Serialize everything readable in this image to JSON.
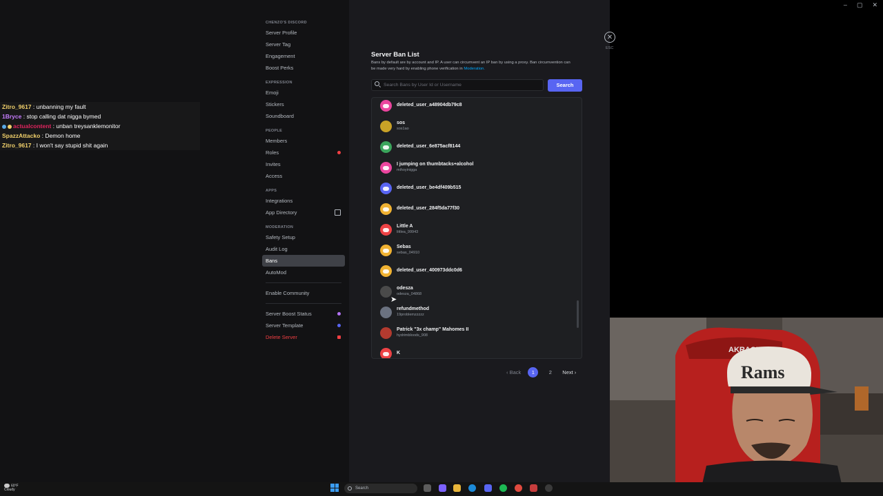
{
  "chat": [
    {
      "user": "Zitro_9617",
      "user_color": "#f2d16b",
      "message": ": unbanning my fault"
    },
    {
      "user": "1Bryce",
      "user_color": "#c77dff",
      "message": ": stop calling dat nigga bymed"
    },
    {
      "user": "actualcontent",
      "user_color": "#e0245e",
      "message": ": unban treysanklemonitor",
      "badges": true
    },
    {
      "user": "SpazzAttacko",
      "user_color": "#f2d16b",
      "message": ": Demon home"
    },
    {
      "user": "Zitro_9617",
      "user_color": "#f2d16b",
      "message": ": I won't say stupid shit again"
    }
  ],
  "sidebar": {
    "server_header": "CHENZO'S DISCORD",
    "items1": [
      "Server Profile",
      "Server Tag",
      "Engagement",
      "Boost Perks"
    ],
    "expression_header": "EXPRESSION",
    "items2": [
      "Emoji",
      "Stickers",
      "Soundboard"
    ],
    "people_header": "PEOPLE",
    "items3": [
      "Members",
      "Roles",
      "Invites",
      "Access"
    ],
    "apps_header": "APPS",
    "items4": [
      "Integrations",
      "App Directory"
    ],
    "moderation_header": "MODERATION",
    "items5": [
      "Safety Setup",
      "Audit Log",
      "Bans",
      "AutoMod"
    ],
    "community": "Enable Community",
    "items6": [
      "Server Boost Status",
      "Server Template"
    ],
    "delete": "Delete Server"
  },
  "main": {
    "esc_label": "ESC",
    "title": "Server Ban List",
    "description": "Bans by default are by account and IP. A user can circumvent an IP ban by using a proxy. Ban circumvention can be made very hard by enabling phone verification in",
    "description_link": "Moderation.",
    "search_placeholder": "Search Bans by User Id or Username",
    "search_button": "Search",
    "bans": [
      {
        "name": "deleted_user_a48904db79c8",
        "username": "",
        "color": "#eb459e"
      },
      {
        "name": "sos",
        "username": "sos1ao",
        "color": "#c9a227",
        "photo": true
      },
      {
        "name": "deleted_user_6e875acf8144",
        "username": "",
        "color": "#3ba55c"
      },
      {
        "name": "I jumping on thumbtacks+alcohol",
        "username": "mihoyinigga",
        "color": "#eb459e"
      },
      {
        "name": "deleted_user_be4df409b515",
        "username": "",
        "color": "#5865f2"
      },
      {
        "name": "deleted_user_284f5da77f30",
        "username": "",
        "color": "#f0b232"
      },
      {
        "name": "Little A",
        "username": "littlea_99943",
        "color": "#ed4245"
      },
      {
        "name": "Sebas",
        "username": "sebas_04910",
        "color": "#f0b232"
      },
      {
        "name": "deleted_user_400973ddc0d6",
        "username": "",
        "color": "#f0b232"
      },
      {
        "name": "odesza",
        "username": "odesza_04868",
        "color": "#4a4a4a",
        "photo": true
      },
      {
        "name": "refundmethod",
        "username": "19problemzzzzz",
        "color": "#6b7280",
        "photo": true
      },
      {
        "name": "Patrick \"3x champ\" Mahomes II",
        "username": "hydrimbloods_908",
        "color": "#b23a2f",
        "photo": true
      },
      {
        "name": "K",
        "username": "",
        "color": "#ed4245"
      }
    ],
    "pagination": {
      "back": "Back",
      "pages": [
        "1",
        "2"
      ],
      "current": "1",
      "next": "Next"
    }
  },
  "webcam": {
    "hat_text": "Rams",
    "chair_text": "AKRACING"
  },
  "taskbar": {
    "weather_temp": "60°F",
    "weather_text": "Cloudy",
    "search": "Search"
  },
  "colors": {
    "accent": "#5865f2",
    "danger": "#f23f43",
    "bg_main": "#1a1a1e",
    "bg_sidebar": "#121214"
  }
}
